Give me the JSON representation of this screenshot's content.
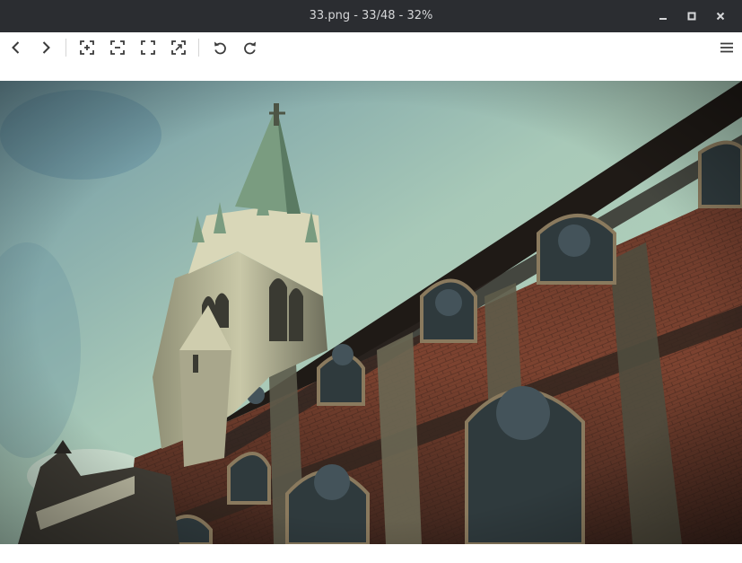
{
  "window": {
    "title": "33.png - 33/48 - 32%",
    "controls": [
      "minimize-icon",
      "maximize-icon",
      "close-icon"
    ]
  },
  "toolbar": {
    "buttons": [
      {
        "name": "previous-button",
        "icon": "chevron-left-icon"
      },
      {
        "name": "next-button",
        "icon": "chevron-right-icon"
      },
      {
        "name": "zoom-in-button",
        "icon": "zoom-in-icon"
      },
      {
        "name": "zoom-out-button",
        "icon": "zoom-out-icon"
      },
      {
        "name": "fit-to-window-button",
        "icon": "fit-icon"
      },
      {
        "name": "original-size-button",
        "icon": "original-size-icon"
      },
      {
        "name": "rotate-left-button",
        "icon": "rotate-left-icon"
      },
      {
        "name": "rotate-right-button",
        "icon": "rotate-right-icon"
      },
      {
        "name": "menu-button",
        "icon": "hamburger-icon"
      }
    ]
  },
  "colors": {
    "titlebar_bg": "#2b2d31",
    "titlebar_text": "#d6d7d9",
    "icon": "#3b3b3b"
  }
}
